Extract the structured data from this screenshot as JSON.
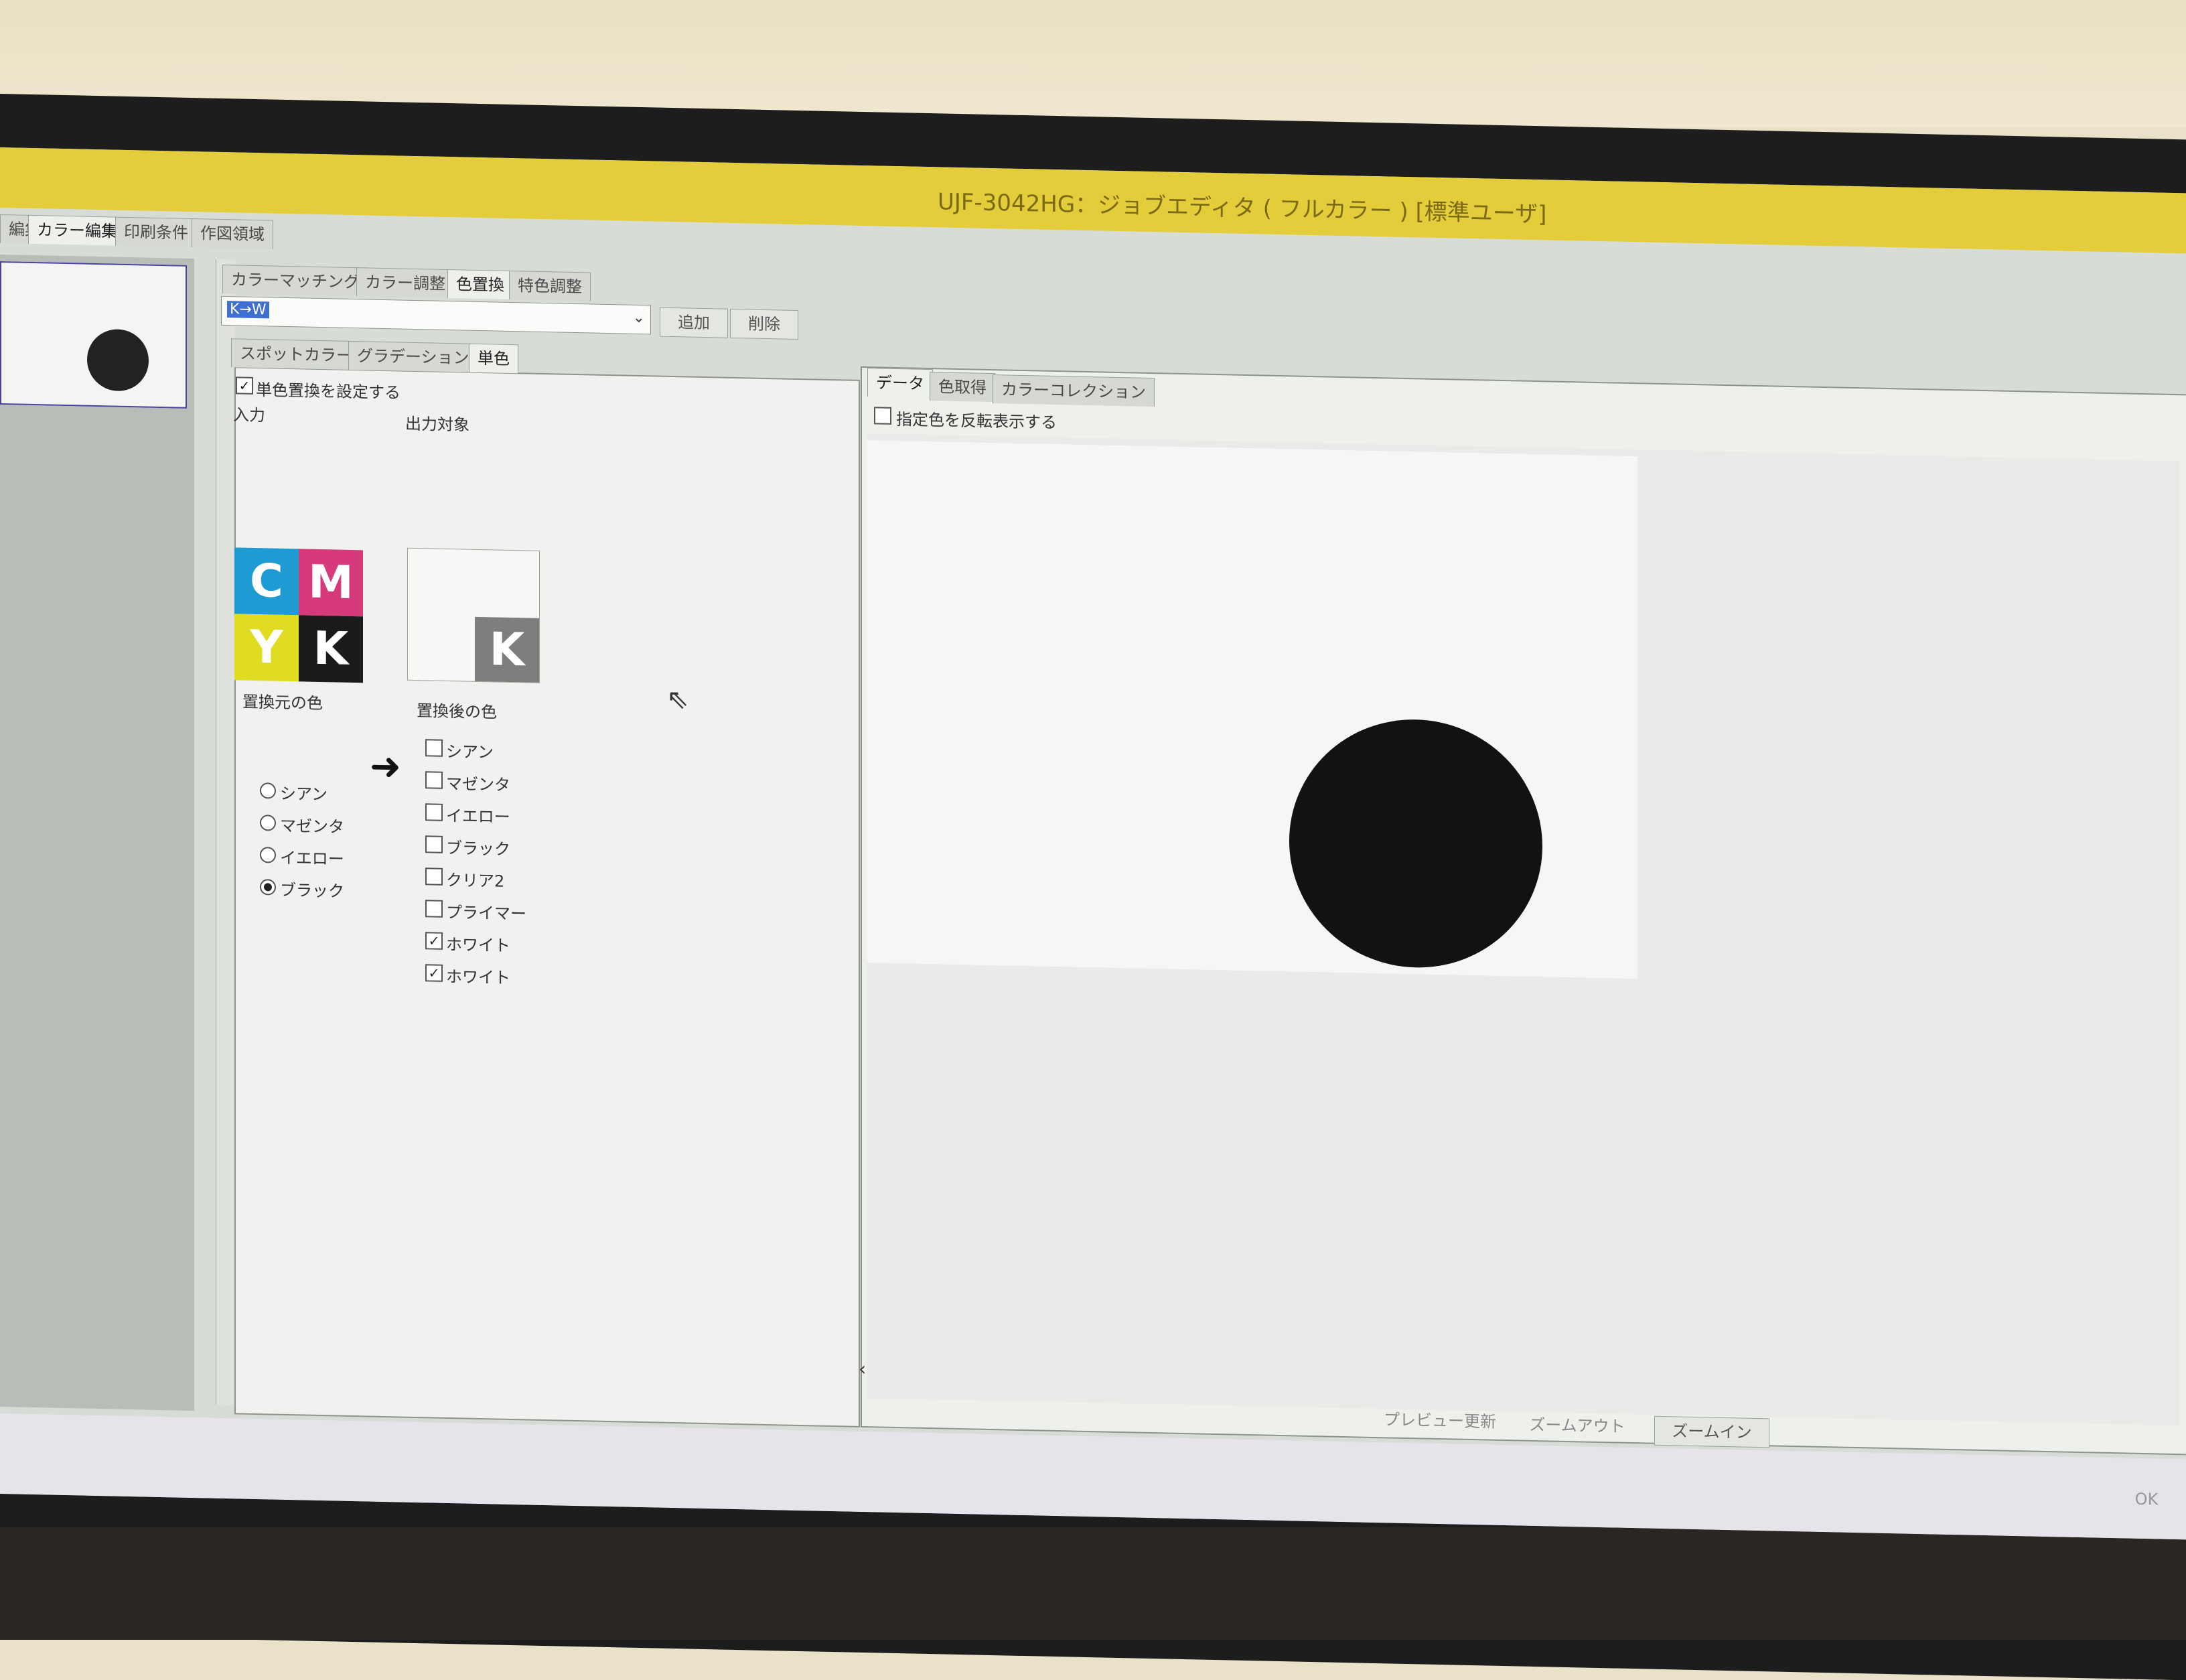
{
  "window": {
    "title": "UJF-3042HG：ジョブエディタ ( フルカラー ) [標準ユーザ]"
  },
  "main_tabs": [
    "編集",
    "カラー編集",
    "印刷条件",
    "作図領域"
  ],
  "color_tabs": [
    "カラーマッチング",
    "カラー調整",
    "色置換",
    "特色調整"
  ],
  "preset": {
    "value": "K→W",
    "add_label": "追加",
    "delete_label": "削除"
  },
  "replace_tabs": [
    "スポットカラー",
    "グラデーション",
    "単色"
  ],
  "single": {
    "enable_label": "単色置換を設定する",
    "input_label": "入力",
    "output_target_label": "出力対象",
    "source_color_label": "置換元の色",
    "dest_color_label": "置換後の色",
    "cmyk": [
      "C",
      "M",
      "Y",
      "K"
    ],
    "output_letter": "K",
    "source_options": [
      "シアン",
      "マゼンタ",
      "イエロー",
      "ブラック"
    ],
    "source_selected": "ブラック",
    "dest_options": [
      {
        "label": "シアン",
        "checked": false
      },
      {
        "label": "マゼンタ",
        "checked": false
      },
      {
        "label": "イエロー",
        "checked": false
      },
      {
        "label": "ブラック",
        "checked": false
      },
      {
        "label": "クリア2",
        "checked": false
      },
      {
        "label": "プライマー",
        "checked": false
      },
      {
        "label": "ホワイト",
        "checked": true
      },
      {
        "label": "ホワイト",
        "checked": true
      }
    ]
  },
  "preview_tabs": [
    "データ",
    "色取得",
    "カラーコレクション"
  ],
  "preview": {
    "invert_label": "指定色を反転表示する",
    "refresh_label": "プレビュー更新",
    "zoom_out_label": "ズームアウト",
    "zoom_in_label": "ズームイン"
  },
  "footer": {
    "ok_label": "OK"
  }
}
